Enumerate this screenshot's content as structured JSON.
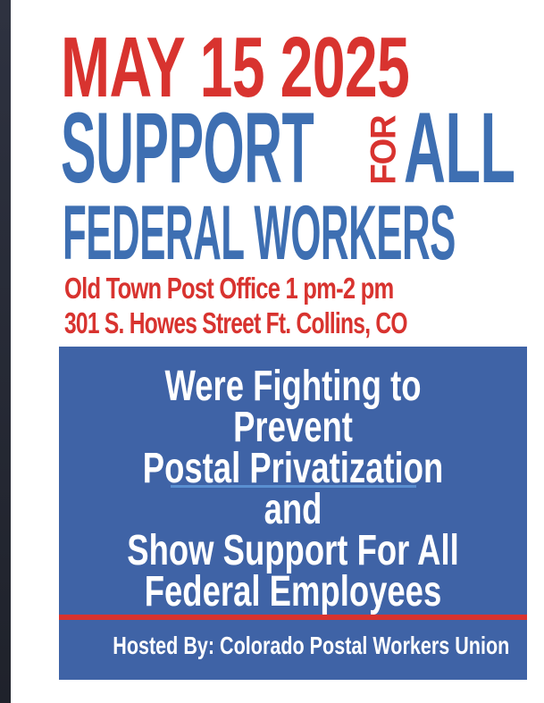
{
  "flyer": {
    "date": "MAY 15 2025",
    "headline_left": "SUPPORT",
    "headline_for": "FOR",
    "headline_right": "ALL",
    "subheadline": "FEDERAL WORKERS",
    "venue_line": "Old Town Post Office  1 pm-2 pm",
    "address_line": "301 S. Howes Street  Ft. Collins, CO",
    "message_lines": [
      "Were Fighting to",
      "Prevent",
      "Postal Privatization",
      "and",
      "Show Support  For All",
      "Federal Employees"
    ],
    "host_line": "Hosted By: Colorado Postal Workers Union"
  },
  "colors": {
    "red": "#d8332f",
    "blue": "#3e6fb2",
    "box_blue": "#3f63a6",
    "white": "#ffffff"
  }
}
